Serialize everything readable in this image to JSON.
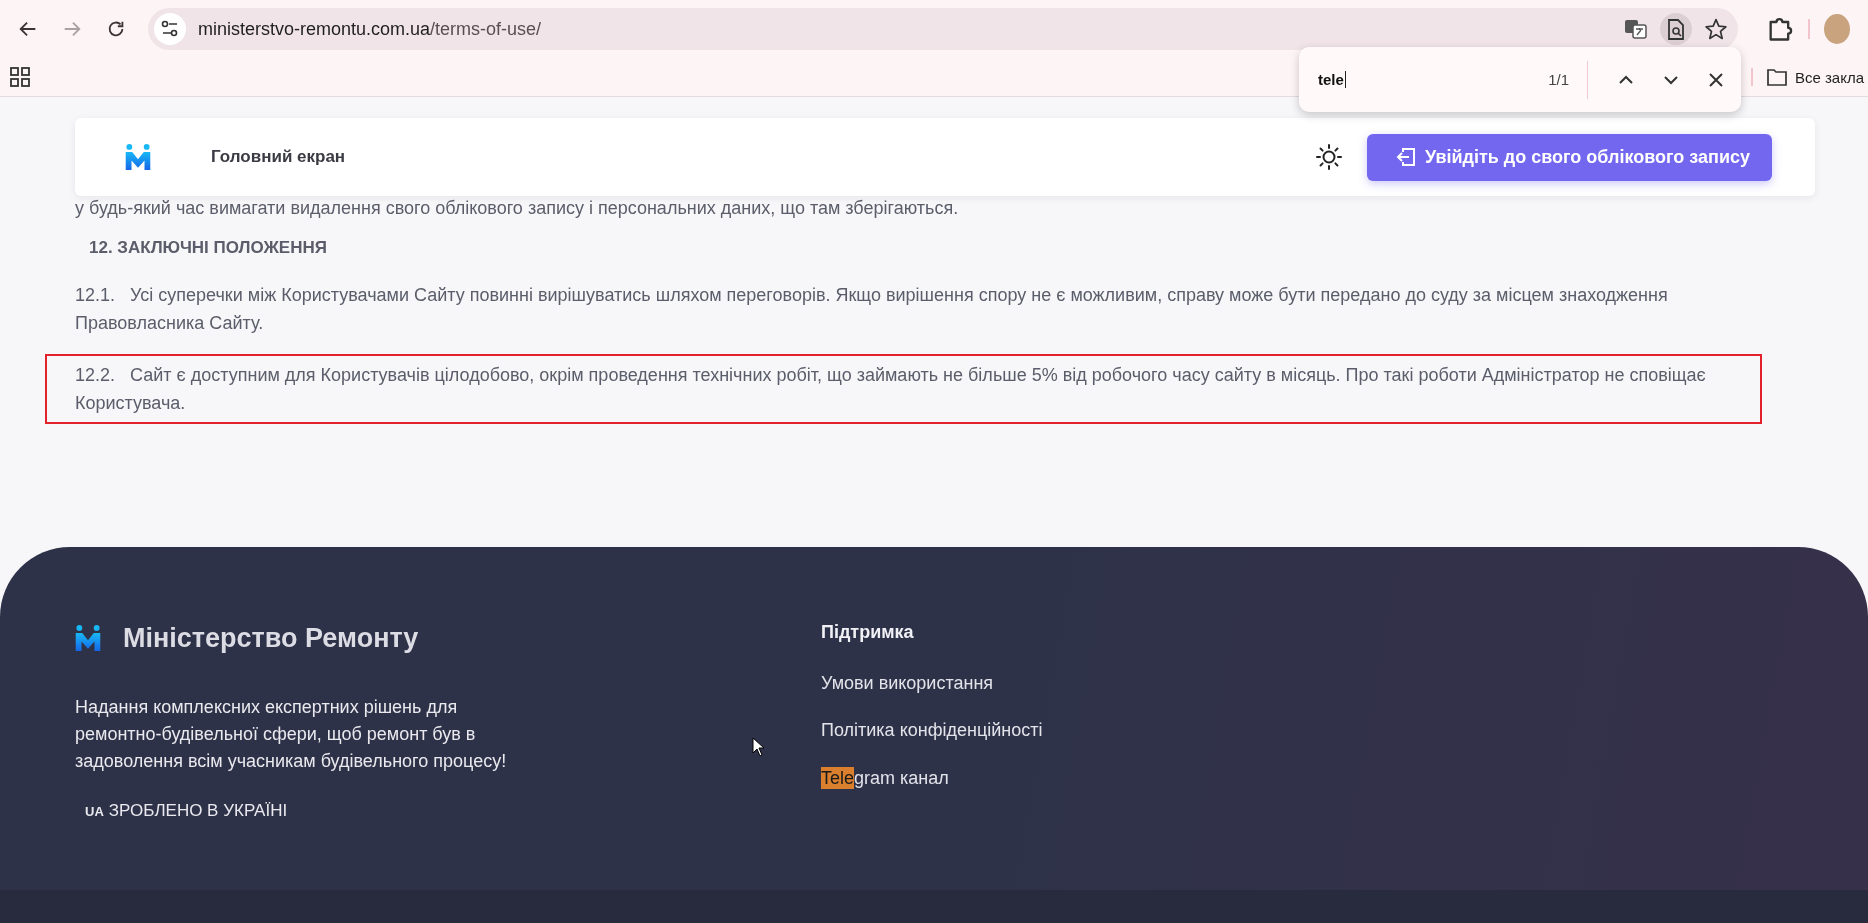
{
  "browser": {
    "nav_buttons": [
      {
        "kind": "back",
        "disabled": false
      },
      {
        "kind": "forward",
        "disabled": true
      },
      {
        "kind": "reload",
        "disabled": false
      }
    ],
    "url": {
      "domain": "ministerstvo-remontu.com.ua",
      "path": "/terms-of-use/"
    },
    "bookmarks": [
      {
        "label": "Все закла"
      }
    ]
  },
  "find_bar": {
    "query": "tele",
    "count": "1/1"
  },
  "site_header": {
    "nav_link": "Головний екран",
    "login_button": "Увійдіть до свого облікового запису"
  },
  "content": {
    "partial_line": "у будь-який час вимагати видалення свого облікового запису і персональних даних, що там зберігаються.",
    "heading": "12. ЗАКЛЮЧНІ ПОЛОЖЕННЯ",
    "clauses": [
      {
        "number": "12.1.",
        "text": "Усі суперечки між Користувачами Сайту повинні вирішуватись шляхом переговорів. Якщо вирішення спору не є можливим, справу може бути передано до суду за місцем знаходження Правовласника Сайту.",
        "highlighted": false
      },
      {
        "number": "12.2.",
        "text": "Сайт є доступним для Користувачів цілодобово, окрім проведення технічних робіт, що займають не більше 5% від робочого часу сайту в місяць. Про такі роботи Адміністратор не сповіщає Користувача.",
        "highlighted": true
      }
    ]
  },
  "footer": {
    "brand": "Міністерство Ремонту",
    "description": "Надання комплексних експертних рішень для ремонтно-будівельної сфери, щоб ремонт був в задоволення всім учасникам будівельного процесу!",
    "made_in": {
      "badge": "UA",
      "text": "ЗРОБЛЕНО В УКРАЇНІ"
    },
    "support": {
      "title": "Підтримка",
      "links": [
        {
          "parts": [
            {
              "text": "Умови використання",
              "found": false
            }
          ]
        },
        {
          "parts": [
            {
              "text": "Політика конфіденційності",
              "found": false
            }
          ]
        },
        {
          "parts": [
            {
              "text": "Tele",
              "found": true
            },
            {
              "text": "gram канал",
              "found": false
            }
          ]
        }
      ]
    }
  }
}
